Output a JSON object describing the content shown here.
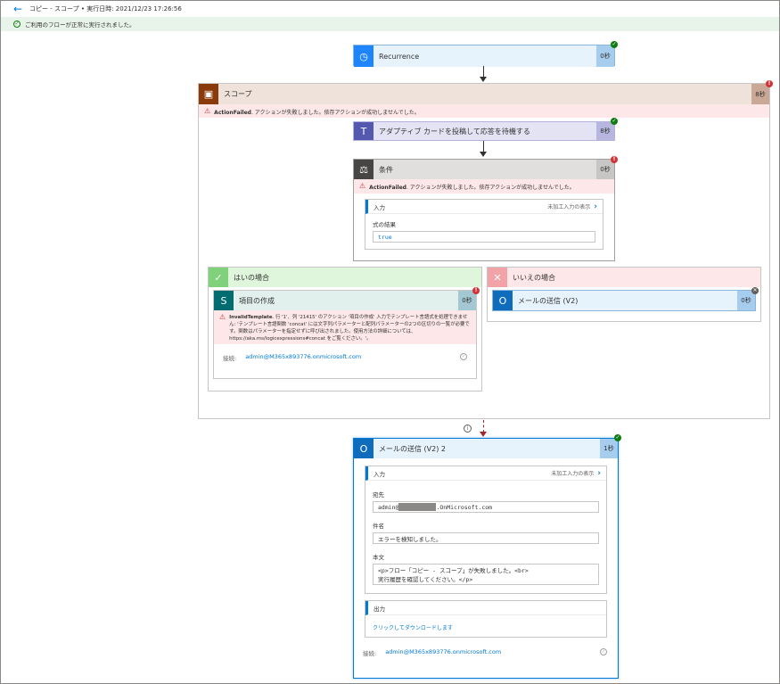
{
  "header": {
    "title": "コピー - スコープ • 実行日時: 2021/12/23 17:26:56",
    "banner": "ご利用のフローが正常に実行されました。"
  },
  "recurrence": {
    "title": "Recurrence",
    "duration": "0秒"
  },
  "scope": {
    "title": "スコープ",
    "duration": "8秒",
    "error_code": "ActionFailed",
    "error_text": ". アクションが失敗しました。依存アクションが成功しませんでした。"
  },
  "teams": {
    "title": "アダプティブ カードを投稿して応答を待機する",
    "duration": "8秒"
  },
  "condition": {
    "title": "条件",
    "duration": "0秒",
    "error_code": "ActionFailed",
    "error_text": ". アクションが失敗しました。依存アクションが成功しませんでした。",
    "input_label": "入力",
    "raw_link": "未加工入力の表示",
    "expr_label": "式の結果",
    "expr_value": "true"
  },
  "yes_branch": {
    "title": "はいの場合",
    "action_title": "項目の作成",
    "duration": "0秒",
    "error_code": "InvalidTemplate",
    "error_text": ". 行 '1'、列 '21415' のアクション '項目の作成' 入力でテンプレート言語式を処理できません: 'テンプレート言語関数 'concat' には文字列パラメーターと配列パラメーターの2つの区切りの一覧が必要です。関数はパラメーターを指定せずに呼び出されました。使用方法の詳細については、https://aka.ms/logicexpressions#concat をご覧ください。'。",
    "conn_label": "接続:",
    "conn_value": "admin@M365x893776.onmicrosoft.com"
  },
  "no_branch": {
    "title": "いいえの場合",
    "action_title": "メールの送信 (V2)",
    "duration": "0秒"
  },
  "mail": {
    "title": "メールの送信 (V2) 2",
    "duration": "1秒",
    "input_label": "入力",
    "raw_link": "未加工入力の表示",
    "to_label": "宛先",
    "to_prefix": "admin@",
    "to_suffix": ".OnMicrosoft.com",
    "subject_label": "件名",
    "subject_value": "エラーを検知しました。",
    "body_label": "本文",
    "body_line1": "<p>フロー「コピー - スコープ」が失敗しました。<br>",
    "body_line2": "実行履歴を確認してください。</p>",
    "output_label": "出力",
    "download_link": "クリックしてダウンロードします",
    "conn_label": "接続:",
    "conn_value": "admin@M365x893776.onmicrosoft.com"
  },
  "info_icon": "i"
}
